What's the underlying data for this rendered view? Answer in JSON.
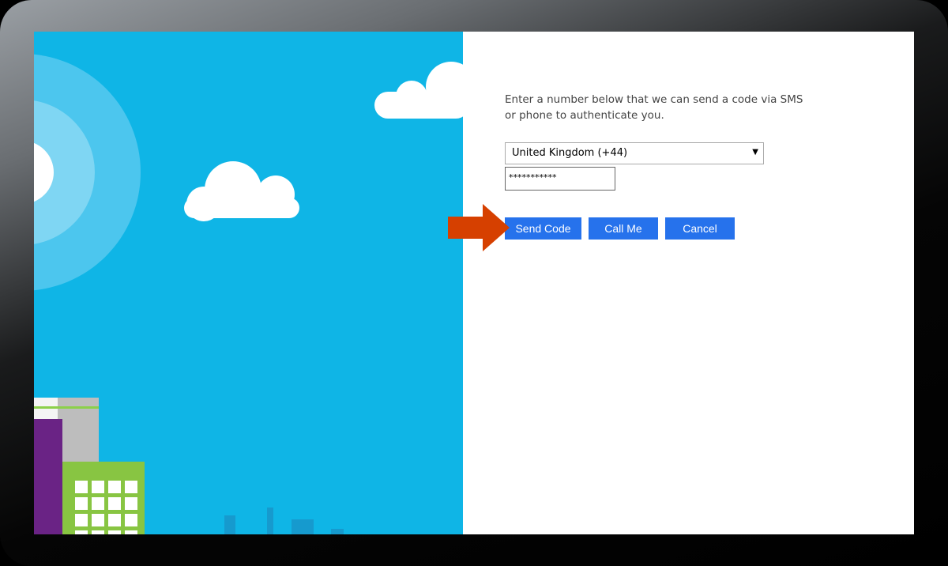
{
  "form": {
    "instruction": "Enter a number below that we can send a code via SMS or phone to authenticate you.",
    "country_select": {
      "value": "United Kingdom (+44)"
    },
    "phone_input": {
      "value": "***********"
    },
    "buttons": {
      "send_code": "Send Code",
      "call_me": "Call Me",
      "cancel": "Cancel"
    }
  },
  "colors": {
    "panel_blue": "#0fb5e6",
    "button_blue": "#2672ec",
    "arrow": "#d64000"
  },
  "annotation": {
    "icon": "arrow-right-icon"
  }
}
